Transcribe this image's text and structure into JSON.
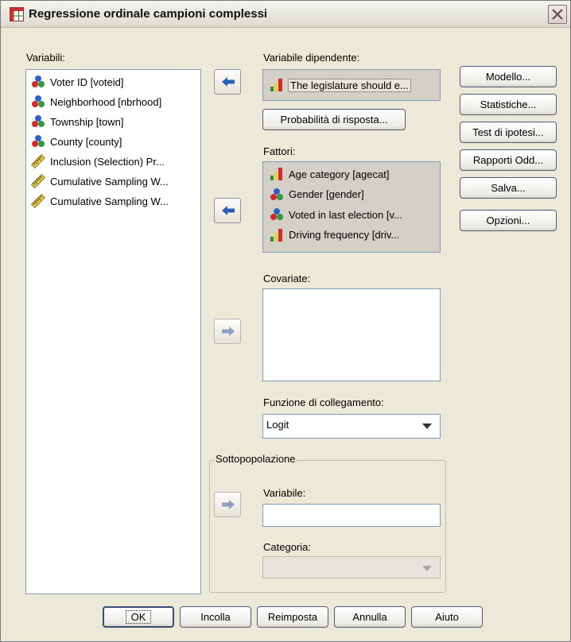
{
  "window": {
    "title": "Regressione ordinale campioni complessi"
  },
  "variables": {
    "label": "Variabili:",
    "items": [
      {
        "label": "Voter ID [voteid]",
        "icon": "nominal-icon"
      },
      {
        "label": "Neighborhood [nbrhood]",
        "icon": "nominal-icon"
      },
      {
        "label": "Township [town]",
        "icon": "nominal-icon"
      },
      {
        "label": "County [county]",
        "icon": "nominal-icon"
      },
      {
        "label": "Inclusion (Selection) Pr...",
        "icon": "scale-icon"
      },
      {
        "label": "Cumulative Sampling W...",
        "icon": "scale-icon"
      },
      {
        "label": "Cumulative Sampling W...",
        "icon": "scale-icon"
      }
    ]
  },
  "dependent": {
    "label": "Variabile dipendente:",
    "value": "The legislature should e...",
    "icon": "ordinal-icon",
    "response_button": "Probabilità di risposta..."
  },
  "factors": {
    "label": "Fattori:",
    "items": [
      {
        "label": "Age category [agecat]",
        "icon": "ordinal-icon"
      },
      {
        "label": "Gender [gender]",
        "icon": "nominal-icon"
      },
      {
        "label": "Voted in last election [v...",
        "icon": "nominal-icon"
      },
      {
        "label": "Driving frequency [driv...",
        "icon": "ordinal-icon"
      }
    ]
  },
  "covariates": {
    "label": "Covariate:"
  },
  "link": {
    "label": "Funzione di collegamento:",
    "value": "Logit"
  },
  "subpop": {
    "title": "Sottopopolazione",
    "variable_label": "Variabile:",
    "variable_value": "",
    "category_label": "Categoria:",
    "category_value": ""
  },
  "side_buttons": {
    "model": "Modello...",
    "statistics": "Statistiche...",
    "hypothesis": "Test di ipotesi...",
    "odds": "Rapporti Odd...",
    "save": "Salva...",
    "options": "Opzioni..."
  },
  "bottom_buttons": {
    "ok": "OK",
    "paste": "Incolla",
    "reset": "Reimposta",
    "cancel": "Annulla",
    "help": "Aiuto"
  },
  "colors": {
    "dialog_bg": "#ece9d8",
    "arrow_active": "#2d5fb5",
    "arrow_disabled": "#8ba0c4",
    "selected_bg": "#d4d0c8"
  }
}
